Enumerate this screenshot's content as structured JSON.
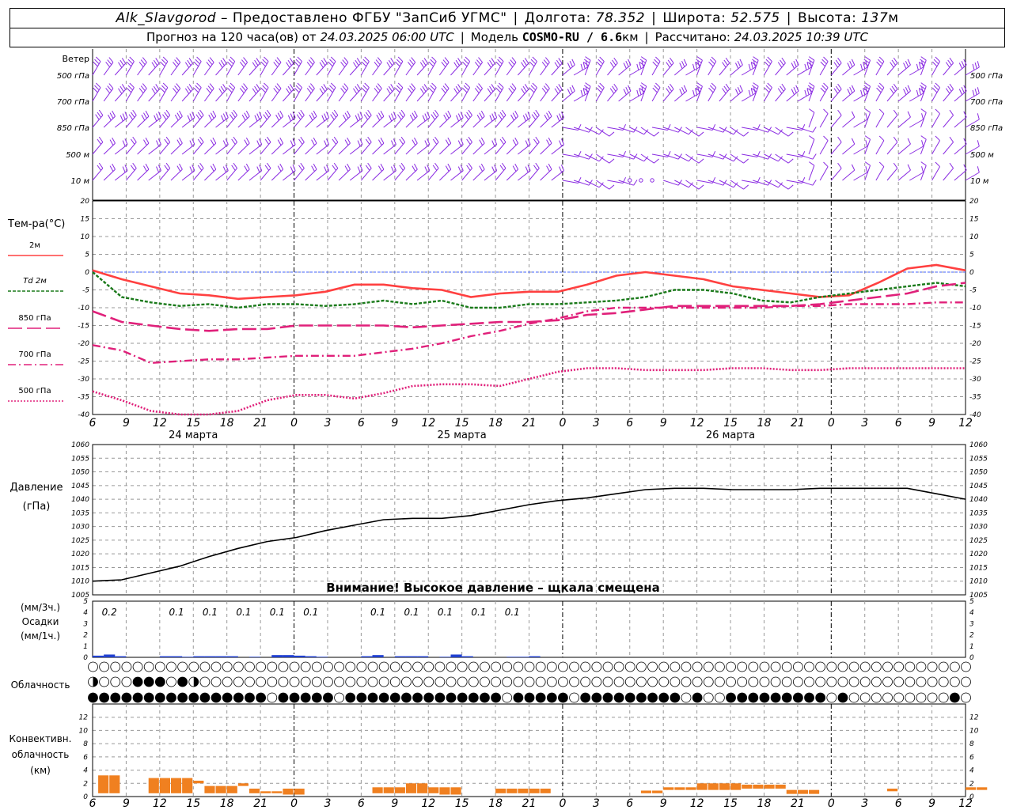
{
  "header": {
    "station": "Alk_Slavgorod",
    "provider": "– Предоставлено ФГБУ \"ЗапСиб УГМС\"",
    "lon_label": "Долгота:",
    "lon_value": "78.352",
    "lat_label": "Широта:",
    "lat_value": "52.575",
    "alt_label": "Высота:",
    "alt_value": "137",
    "alt_unit": "м",
    "forecast_prefix": "Прогноз на 120 часа(ов) от",
    "forecast_start": "24.03.2025 06:00 UTC",
    "model_label": "Модель",
    "model_name": "COSMO-RU / 6.6",
    "model_unit": "км",
    "calc_label": "Рассчитано:",
    "calc_time": "24.03.2025 10:39 UTC"
  },
  "colors": {
    "wind": "#8a2be2",
    "t2m": "#ff4040",
    "td2m": "#1a7a1a",
    "t850": "#e0207a",
    "t700": "#e0207a",
    "t500": "#e0207a",
    "pressure": "#000000",
    "precip": "#2040d0",
    "conv": "#f08020",
    "grid": "#999999",
    "zero_line": "#4060ff"
  },
  "time_axis": {
    "hour_labels": [
      "6",
      "9",
      "12",
      "15",
      "18",
      "21",
      "0",
      "3",
      "6",
      "9",
      "12",
      "15",
      "18",
      "21",
      "0",
      "3",
      "6",
      "9",
      "12",
      "15",
      "18",
      "21",
      "0",
      "3",
      "6",
      "9",
      "12"
    ],
    "day_labels": [
      "24 марта",
      "25 марта",
      "26 марта"
    ]
  },
  "wind": {
    "title": "Ветер",
    "levels": [
      "500 гПа",
      "700 гПа",
      "850 гПа",
      "500 м",
      "10 м"
    ]
  },
  "chart_data": [
    {
      "type": "line",
      "title": "Тем-ра(°С)",
      "ylim": [
        -40,
        20
      ],
      "yticks": [
        "20",
        "15",
        "10",
        "5",
        "0",
        "-5",
        "-10",
        "-15",
        "-20",
        "-25",
        "-30",
        "-35",
        "-40"
      ],
      "x": [
        6,
        9,
        12,
        15,
        18,
        21,
        24,
        27,
        30,
        33,
        36,
        39,
        42,
        45,
        48,
        51,
        54,
        57,
        60,
        63,
        66,
        69,
        72,
        75,
        78,
        81,
        84
      ],
      "series": [
        {
          "name": "2м",
          "values": [
            0.5,
            -2,
            -4,
            -6,
            -6.5,
            -7.5,
            -7,
            -6.5,
            -5.5,
            -3.5,
            -3.5,
            -4.5,
            -5,
            -7,
            -6,
            -5.5,
            -5.5,
            -3.5,
            -1,
            0,
            -1,
            -2,
            -4,
            -5,
            -6,
            -7,
            -6.5,
            -3,
            1,
            2,
            0.5
          ]
        },
        {
          "name": "Td  2м",
          "values": [
            0,
            -7,
            -8.5,
            -9.5,
            -9,
            -10,
            -9,
            -9,
            -9.5,
            -9,
            -8,
            -9,
            -8,
            -10,
            -10,
            -9,
            -9,
            -8.5,
            -8,
            -7,
            -5,
            -5,
            -6,
            -8,
            -8.5,
            -7,
            -6,
            -5,
            -4,
            -3,
            -4
          ]
        },
        {
          "name": "850 гПа",
          "values": [
            -11,
            -14,
            -15,
            -16,
            -16.5,
            -16,
            -16,
            -15,
            -15,
            -15,
            -15,
            -15.5,
            -15,
            -14.5,
            -14,
            -14,
            -13.5,
            -12,
            -11.5,
            -10.5,
            -9.5,
            -9.5,
            -9.5,
            -9.5,
            -9.5,
            -9,
            -8,
            -7,
            -6,
            -4,
            -3
          ]
        },
        {
          "name": "700 гПа",
          "values": [
            -20.5,
            -22,
            -25.5,
            -25,
            -24.5,
            -24.5,
            -24,
            -23.5,
            -23.5,
            -23.5,
            -22.5,
            -21.5,
            -20,
            -18,
            -16.5,
            -14.5,
            -13,
            -11,
            -10,
            -10,
            -10,
            -10,
            -10,
            -10,
            -9.5,
            -9.5,
            -9,
            -9,
            -9,
            -8.5,
            -8.5
          ]
        },
        {
          "name": "500 гПа",
          "values": [
            -33.5,
            -36,
            -39,
            -40,
            -41,
            -39,
            -36,
            -34.5,
            -34.5,
            -35.5,
            -34,
            -32,
            -31.5,
            -31.5,
            -32,
            -30,
            -28,
            -27,
            -27,
            -27.5,
            -27.5,
            -27.5,
            -27,
            -27,
            -27.5,
            -27.5,
            -27,
            -27,
            -27,
            -27,
            -27
          ]
        }
      ]
    },
    {
      "type": "line",
      "title": "Давление",
      "unit": "(гПа)",
      "ylim": [
        1005,
        1060
      ],
      "yticks": [
        "1060",
        "1055",
        "1050",
        "1045",
        "1040",
        "1035",
        "1030",
        "1025",
        "1020",
        "1015",
        "1010",
        "1005"
      ],
      "note": "Внимание! Высокое давление – щкала смещена",
      "series": [
        {
          "name": "",
          "values": [
            1010,
            1010.5,
            1013,
            1015.5,
            1019,
            1022,
            1024.5,
            1026,
            1028.5,
            1030.5,
            1032.5,
            1033,
            1033,
            1034,
            1036,
            1038,
            1039.5,
            1040.5,
            1042,
            1043.5,
            1044,
            1044,
            1043.5,
            1043.5,
            1043.5,
            1044,
            1044,
            1044,
            1044,
            1042,
            1040
          ]
        }
      ]
    },
    {
      "type": "bar",
      "title": "Осадки",
      "unit_3h": "(мм/3ч.)",
      "unit_1h": "(мм/1ч.)",
      "ylim": [
        0,
        5
      ],
      "yticks": [
        "5",
        "4",
        "3",
        "2",
        "1",
        "0"
      ],
      "labels": [
        {
          "hour": 7.5,
          "text": "0.2"
        },
        {
          "hour": 13.5,
          "text": "0.1"
        },
        {
          "hour": 16.5,
          "text": "0.1"
        },
        {
          "hour": 19.5,
          "text": "0.1"
        },
        {
          "hour": 22.5,
          "text": "0.1"
        },
        {
          "hour": 25.5,
          "text": "0.1"
        },
        {
          "hour": 31.5,
          "text": "0.1"
        },
        {
          "hour": 34.5,
          "text": "0.1"
        },
        {
          "hour": 37.5,
          "text": "0.1"
        },
        {
          "hour": 40.5,
          "text": "0.1"
        },
        {
          "hour": 43.5,
          "text": "0.1"
        }
      ],
      "bars": [
        {
          "hour": 6,
          "value": 0.15
        },
        {
          "hour": 7,
          "value": 0.25
        },
        {
          "hour": 8,
          "value": 0.1
        },
        {
          "hour": 12,
          "value": 0.1
        },
        {
          "hour": 13,
          "value": 0.1
        },
        {
          "hour": 14,
          "value": 0.05
        },
        {
          "hour": 15,
          "value": 0.1
        },
        {
          "hour": 16,
          "value": 0.1
        },
        {
          "hour": 17,
          "value": 0.1
        },
        {
          "hour": 18,
          "value": 0.1
        },
        {
          "hour": 20,
          "value": 0.05
        },
        {
          "hour": 22,
          "value": 0.2
        },
        {
          "hour": 23,
          "value": 0.2
        },
        {
          "hour": 24,
          "value": 0.15
        },
        {
          "hour": 25,
          "value": 0.1
        },
        {
          "hour": 26,
          "value": 0.05
        },
        {
          "hour": 30,
          "value": 0.1
        },
        {
          "hour": 31,
          "value": 0.2
        },
        {
          "hour": 33,
          "value": 0.1
        },
        {
          "hour": 34,
          "value": 0.1
        },
        {
          "hour": 35,
          "value": 0.1
        },
        {
          "hour": 37,
          "value": 0.05
        },
        {
          "hour": 38,
          "value": 0.25
        },
        {
          "hour": 39,
          "value": 0.1
        },
        {
          "hour": 43,
          "value": 0.05
        },
        {
          "hour": 44,
          "value": 0.05
        },
        {
          "hour": 45,
          "value": 0.1
        }
      ]
    },
    {
      "type": "table",
      "title": "Облачность",
      "note": "cloud cover per hour, 3 levels (top/mid/low), 0-4 eighths-of-circle fill",
      "rows": [
        "00000000000000000000000000000000000000000000000000000000000000000000000000000000000000000000000000000000000000000000000000000000000000000000000000",
        "30004440430000000000000000000000000000000000000000000000000000000000000000000000000000000000000000000000000000000000000000000000000000000000000000",
        "44444444444444440444440444444444444440444440444444444040044444444404000000000400000000000000000000000000000000000000000000000000000000000000000000"
      ]
    },
    {
      "type": "bar",
      "title": "Конвективн.",
      "title2": "облачность",
      "unit": "(км)",
      "ylim": [
        0,
        14
      ],
      "yticks": [
        "12",
        "10",
        "8",
        "6",
        "4",
        "2",
        "0"
      ],
      "blocks": [
        {
          "h0": 6.5,
          "h1": 8,
          "bottom": 0.5,
          "top": 3.2
        },
        {
          "h0": 11,
          "h1": 15,
          "bottom": 0.5,
          "top": 2.8
        },
        {
          "h0": 15,
          "h1": 16,
          "bottom": 2.0,
          "top": 2.4
        },
        {
          "h0": 16,
          "h1": 19,
          "bottom": 0.5,
          "top": 1.6
        },
        {
          "h0": 19,
          "h1": 20,
          "bottom": 1.6,
          "top": 2.0
        },
        {
          "h0": 20,
          "h1": 21,
          "bottom": 0.5,
          "top": 1.2
        },
        {
          "h0": 21,
          "h1": 23,
          "bottom": 0.5,
          "top": 0.8
        },
        {
          "h0": 23,
          "h1": 25,
          "bottom": 0.3,
          "top": 1.2
        },
        {
          "h0": 31,
          "h1": 34,
          "bottom": 0.5,
          "top": 1.4
        },
        {
          "h0": 34,
          "h1": 36,
          "bottom": 0.5,
          "top": 2.0
        },
        {
          "h0": 36,
          "h1": 37,
          "bottom": 0.5,
          "top": 1.4
        },
        {
          "h0": 37,
          "h1": 39,
          "bottom": 0.3,
          "top": 1.4
        },
        {
          "h0": 42,
          "h1": 47,
          "bottom": 0.5,
          "top": 1.2
        },
        {
          "h0": 55,
          "h1": 57,
          "bottom": 0.5,
          "top": 0.9
        },
        {
          "h0": 57,
          "h1": 60,
          "bottom": 1.0,
          "top": 1.4
        },
        {
          "h0": 60,
          "h1": 64,
          "bottom": 1.0,
          "top": 2.0
        },
        {
          "h0": 64,
          "h1": 68,
          "bottom": 1.2,
          "top": 1.8
        },
        {
          "h0": 68,
          "h1": 71,
          "bottom": 0.4,
          "top": 1.0
        },
        {
          "h0": 77,
          "h1": 78,
          "bottom": 0.8,
          "top": 1.2
        },
        {
          "h0": 84,
          "h1": 86,
          "bottom": 1.0,
          "top": 1.4
        }
      ]
    }
  ]
}
